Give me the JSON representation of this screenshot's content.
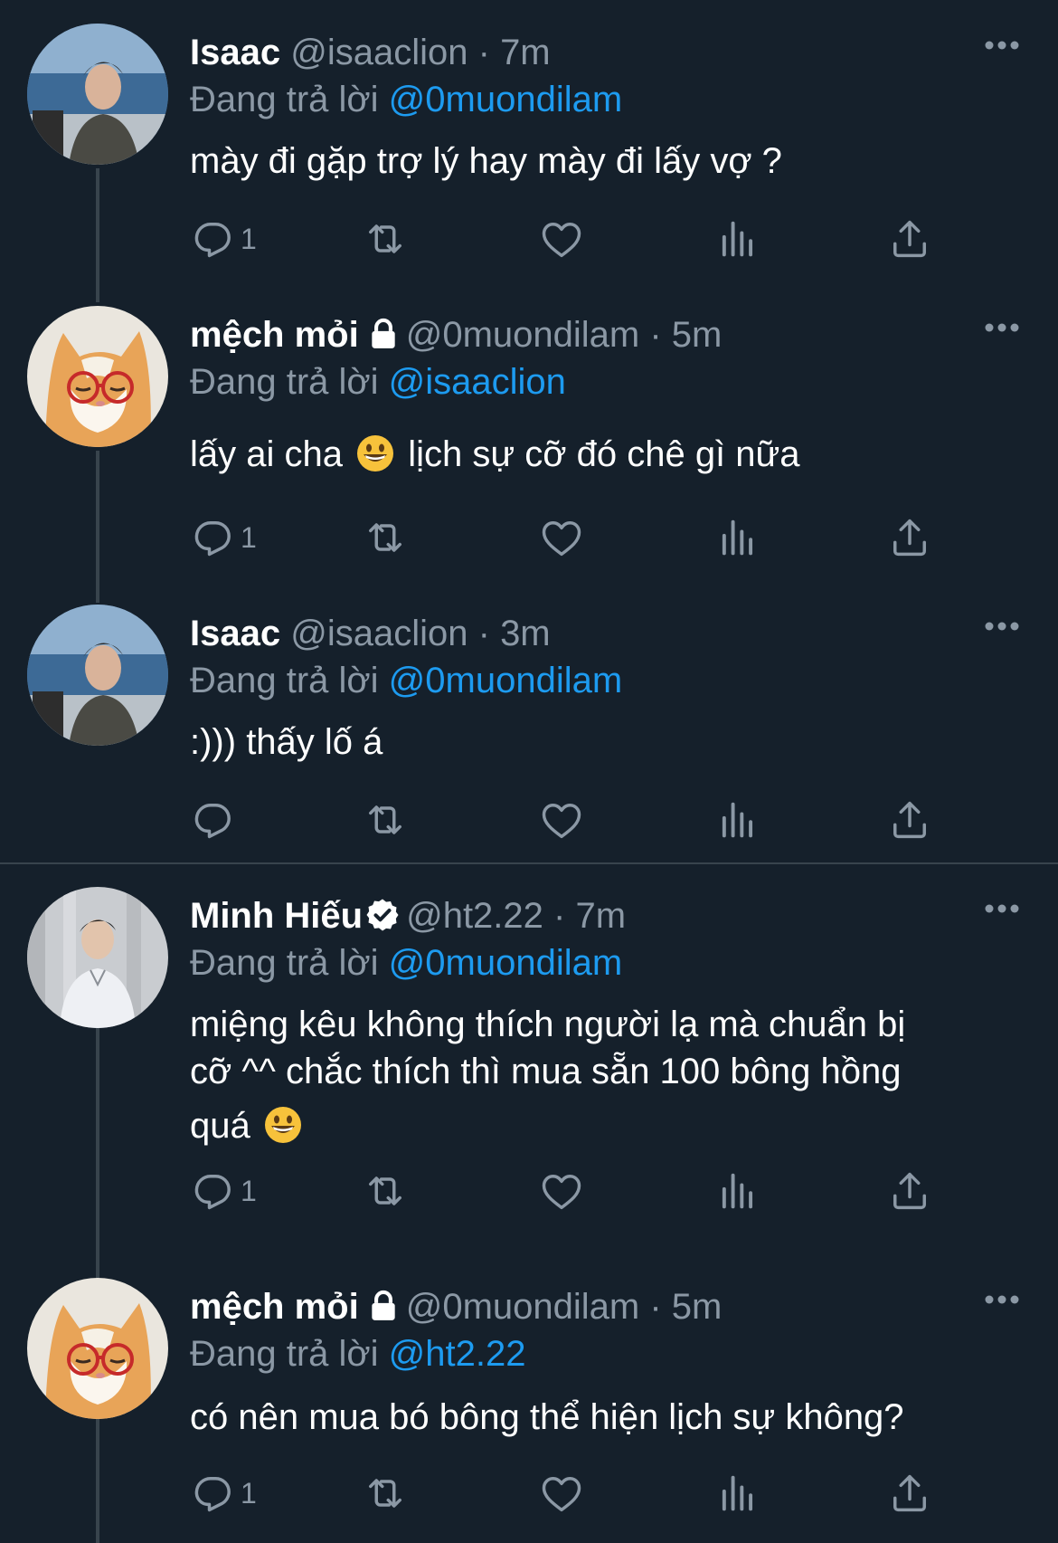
{
  "tweets": [
    {
      "name": "Isaac",
      "handle": "@isaaclion",
      "dot": "·",
      "time": "7m",
      "replying_label": "Đang trả lời",
      "mention": "@0muondilam",
      "text": "mày đi gặp trợ lý hay mày đi lấy vợ ?",
      "reply_count": "1",
      "locked": false,
      "verified": false
    },
    {
      "name": "mệch mỏi",
      "handle": "@0muondilam",
      "dot": "·",
      "time": "5m",
      "replying_label": "Đang trả lời",
      "mention": "@isaaclion",
      "text_before": "lấy ai cha",
      "text_after": "lịch sự cỡ đó chê gì nữa",
      "reply_count": "1",
      "locked": true,
      "verified": false
    },
    {
      "name": "Isaac",
      "handle": "@isaaclion",
      "dot": "·",
      "time": "3m",
      "replying_label": "Đang trả lời",
      "mention": "@0muondilam",
      "text": ":))) thấy lố á",
      "reply_count": "",
      "locked": false,
      "verified": false
    },
    {
      "name": "Minh Hiếu",
      "handle": "@ht2.22",
      "dot": "·",
      "time": "7m",
      "replying_label": "Đang trả lời",
      "mention": "@0muondilam",
      "text_line1": "miệng kêu không thích người lạ mà chuẩn bị",
      "text_line2": "cỡ ^^ chắc thích thì mua sẵn 100 bông hồng",
      "text_line3": "quá",
      "reply_count": "1",
      "locked": false,
      "verified": true
    },
    {
      "name": "mệch mỏi",
      "handle": "@0muondilam",
      "dot": "·",
      "time": "5m",
      "replying_label": "Đang trả lời",
      "mention": "@ht2.22",
      "text": "có nên mua bó bông thể hiện lịch sự không?",
      "reply_count": "1",
      "locked": true,
      "verified": false
    }
  ],
  "icons": {
    "reply": "reply-icon",
    "retweet": "retweet-icon",
    "like": "heart-icon",
    "views": "views-icon",
    "share": "share-icon",
    "more": "more-icon",
    "lock": "lock-icon",
    "verified": "verified-icon"
  },
  "colors": {
    "background": "#15202b",
    "secondary_text": "#8b98a5",
    "mention": "#1d9bf0",
    "thread_line": "#38444d"
  }
}
